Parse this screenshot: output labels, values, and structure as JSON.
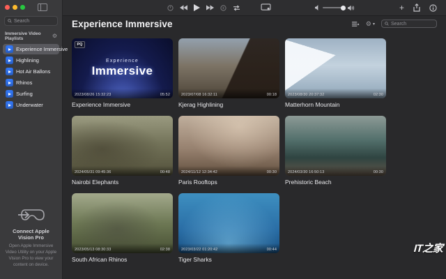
{
  "titlebar": {
    "traffic_lights": [
      "#ff5f57",
      "#febc2e",
      "#28c840"
    ]
  },
  "sidebar": {
    "search_placeholder": "Search",
    "section_title": "Immersive Video Playlists",
    "items": [
      {
        "label": "Experience Immersive",
        "selected": true
      },
      {
        "label": "Highlining",
        "selected": false
      },
      {
        "label": "Hot Air Ballons",
        "selected": false
      },
      {
        "label": "Rhinos",
        "selected": false
      },
      {
        "label": "Surfing",
        "selected": false
      },
      {
        "label": "Underwater",
        "selected": false
      }
    ],
    "footer": {
      "title": "Connect Apple Vision Pro",
      "description": "Open Apple Immersive Video Utility on your Apple Vision Pro to view your content on device."
    }
  },
  "toolbar": {
    "add_label": "+"
  },
  "main": {
    "title": "Experience Immersive",
    "search_placeholder": "Search",
    "gear_chevron": "▾",
    "videos": [
      {
        "title": "Experience Immersive",
        "timestamp": "2023/08/26 15:32:23",
        "duration": "05:52",
        "badge": "PQ",
        "poster": {
          "line1": "Experience",
          "line2": "Immersive"
        },
        "thumb_css": "radial-gradient(ellipse at 50% 118%, #5a74d8 0%, #32418f 30%, #141b4d 60%, #0a0e2c 100%)"
      },
      {
        "title": "Kjerag Highlining",
        "timestamp": "2023/07/08 16:32:11",
        "duration": "00:18",
        "thumb_css": "linear-gradient(115deg, rgba(40,30,22,0) 55%, rgba(35,26,20,0.9) 56%), linear-gradient(180deg, #93a0ad 0%, #7d7466 45%, #4e4538 100%)"
      },
      {
        "title": "Matterhorn Mountain",
        "timestamp": "2023/08/30 20:37:32",
        "duration": "02:30",
        "thumb_css": "conic-gradient(from 235deg at 50% 28%, rgba(246,249,252,0.95) 0deg 52deg, rgba(0,0,0,0) 52deg), linear-gradient(180deg, #9fb2c4 0%, #c3d2de 45%, #8fa5b8 100%)"
      },
      {
        "title": "Nairobi Elephants",
        "timestamp": "2024/05/31 09:45:36",
        "duration": "00:48",
        "thumb_css": "radial-gradient(ellipse at 30% 55%, rgba(60,55,40,.55), rgba(0,0,0,0) 60%), linear-gradient(180deg, #9a9a80 0%, #74745a 45%, #52503a 100%)"
      },
      {
        "title": "Paris Rooftops",
        "timestamp": "2024/11/12 12:34:42",
        "duration": "00:30",
        "thumb_css": "radial-gradient(ellipse at 60% 18%, rgba(240,222,200,.5), rgba(0,0,0,0) 60%), linear-gradient(180deg, #bfae9c 0%, #97816f 55%, #62503f 100%)"
      },
      {
        "title": "Prehistoric Beach",
        "timestamp": "2024/03/30 16:50:13",
        "duration": "00:30",
        "thumb_css": "linear-gradient(180deg, #8d9a96 0%, #53706c 40%, #2f4441 70%, #64574a 100%)"
      },
      {
        "title": "South African Rhinos",
        "timestamp": "2023/05/13 08:30:33",
        "duration": "02:38",
        "thumb_css": "radial-gradient(ellipse at 45% 60%, rgba(70,70,60,.5), rgba(0,0,0,0) 55%), linear-gradient(180deg, #a3a98c 0%, #6d7854 50%, #474f33 100%)"
      },
      {
        "title": "Tiger Sharks",
        "timestamp": "2023/03/22 01:20:42",
        "duration": "00:44",
        "thumb_css": "radial-gradient(ellipse at 50% 85%, rgba(135,205,238,.55), rgba(0,0,0,0) 70%), linear-gradient(180deg, #3e8fc0 0%, #2a6ea6 60%, #174f82 100%)"
      }
    ]
  },
  "watermark": "IT之家",
  "colors": {
    "sidebar_bg": "#3a3a3c",
    "main_bg": "#29292b",
    "titlebar_bg": "#2e2e30",
    "selection": "#59595e",
    "playlist_icon_blue": "#3478f6"
  }
}
